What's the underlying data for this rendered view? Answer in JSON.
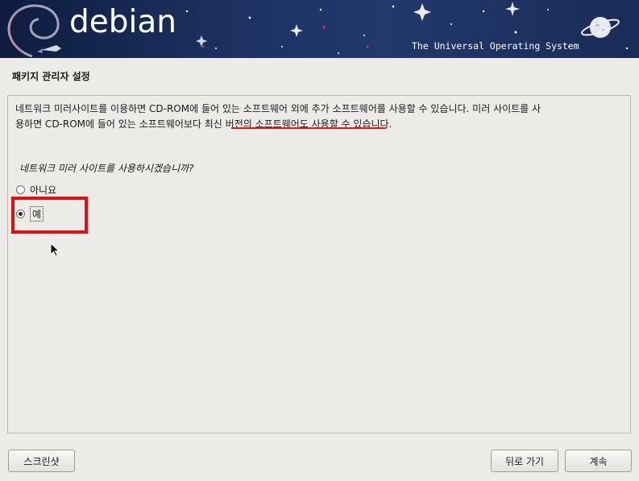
{
  "banner": {
    "logo_text": "debian",
    "tagline": "The Universal Operating System"
  },
  "page": {
    "title": "패키지 관리자 설정"
  },
  "content": {
    "description_line1": "네트워크 미러사이트를 이용하면 CD-ROM에 들어 있는 소프트웨어 외에 추가 소프트웨어를 사용할 수 있습니다. 미러 사이트를 사",
    "description_line2": "용하면 CD-ROM에 들어 있는 소프트웨어보다 최신 버전의 소프트웨어도 사용할 수 있습니다.",
    "question": "네트워크 미러 사이트를 사용하시겠습니까?",
    "options": [
      {
        "label": "아니요",
        "selected": false
      },
      {
        "label": "예",
        "selected": true
      }
    ]
  },
  "buttons": {
    "screenshot": "스크린샷",
    "back": "뒤로 가기",
    "continue": "계속"
  },
  "colors": {
    "annotation_red": "#e01010",
    "banner_blue": "#1c3160"
  }
}
